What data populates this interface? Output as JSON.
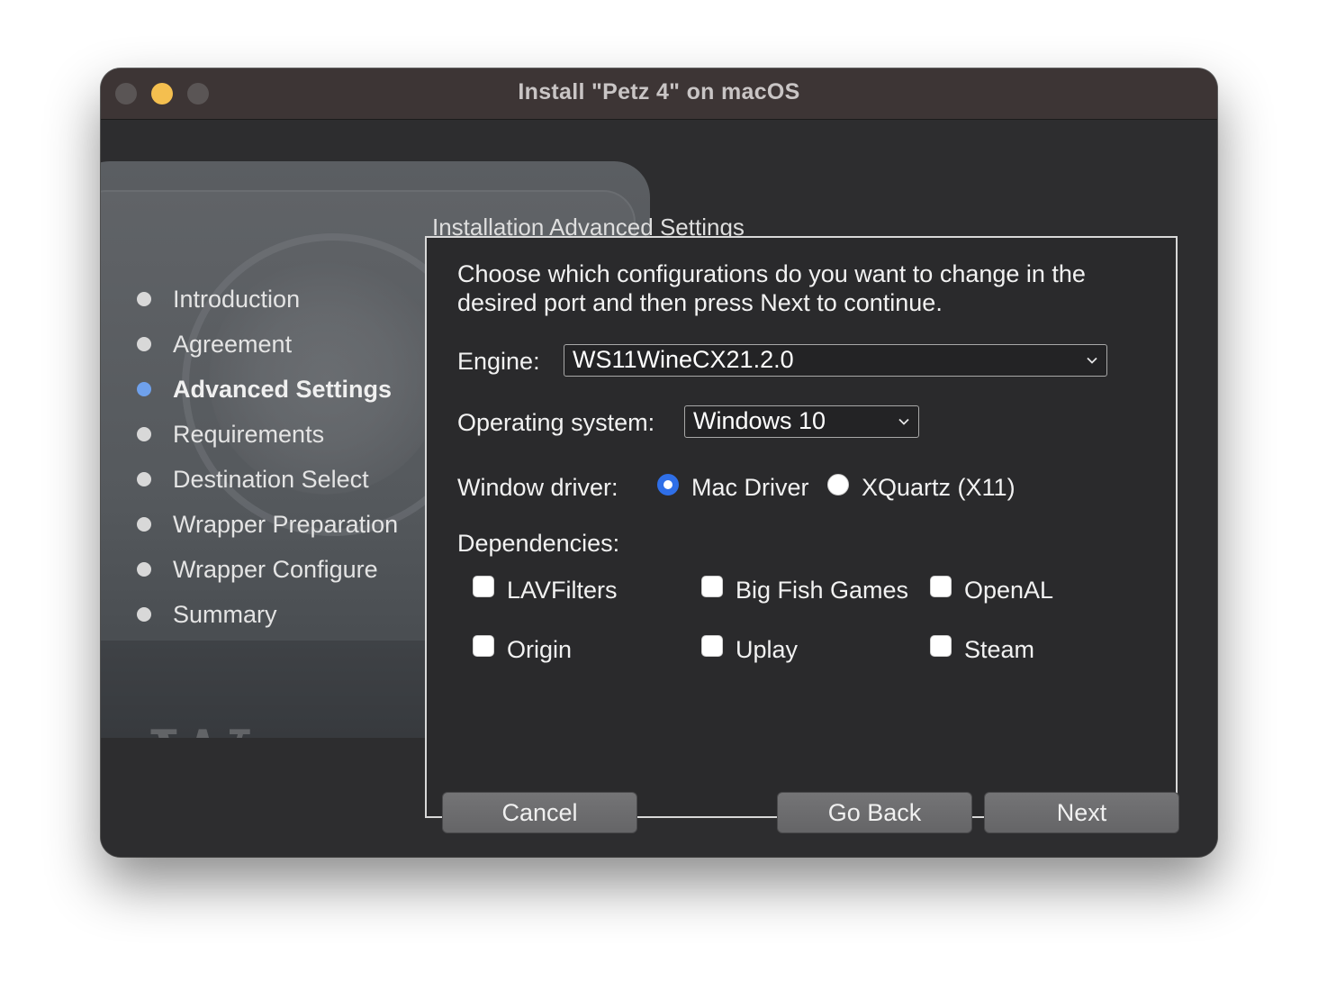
{
  "window": {
    "title": "Install \"Petz 4\" on macOS"
  },
  "section_title": "Installation Advanced Settings",
  "steps": [
    {
      "label": "Introduction",
      "active": false
    },
    {
      "label": "Agreement",
      "active": false
    },
    {
      "label": "Advanced Settings",
      "active": true
    },
    {
      "label": "Requirements",
      "active": false
    },
    {
      "label": "Destination Select",
      "active": false
    },
    {
      "label": "Wrapper Preparation",
      "active": false
    },
    {
      "label": "Wrapper Configure",
      "active": false
    },
    {
      "label": "Summary",
      "active": false
    }
  ],
  "background_art": {
    "logo_text": "Wrapper"
  },
  "panel": {
    "description": "Choose which configurations do you want to change in the desired port and then press Next to continue.",
    "engine": {
      "label": "Engine:",
      "value": "WS11WineCX21.2.0"
    },
    "os": {
      "label": "Operating system:",
      "value": "Windows 10"
    },
    "window_driver": {
      "label": "Window driver:",
      "options": [
        {
          "label": "Mac Driver",
          "selected": true
        },
        {
          "label": "XQuartz (X11)",
          "selected": false
        }
      ]
    },
    "dependencies": {
      "label": "Dependencies:",
      "items": [
        {
          "label": "LAVFilters",
          "checked": false
        },
        {
          "label": "Big Fish Games",
          "checked": false
        },
        {
          "label": "OpenAL",
          "checked": false
        },
        {
          "label": "Origin",
          "checked": false
        },
        {
          "label": "Uplay",
          "checked": false
        },
        {
          "label": "Steam",
          "checked": false
        }
      ]
    }
  },
  "buttons": {
    "cancel": "Cancel",
    "go_back": "Go Back",
    "next": "Next"
  },
  "colors": {
    "accent": "#2f6fe8",
    "active_step_dot": "#6fa1ec",
    "minimize_button": "#f4bf4f"
  }
}
